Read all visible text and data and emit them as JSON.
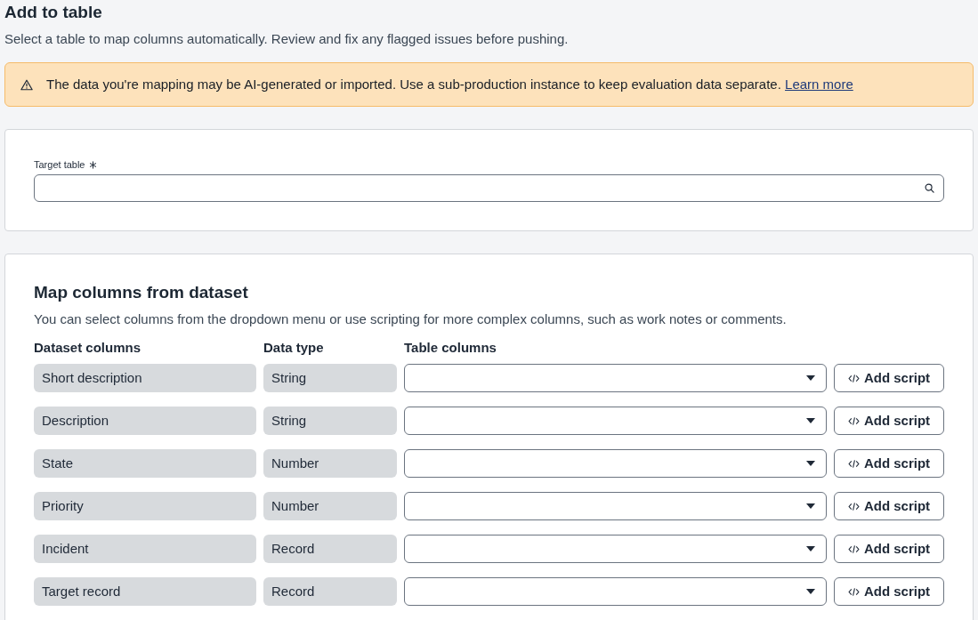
{
  "page": {
    "title": "Add to table",
    "subtitle": "Select a table to map columns automatically. Review and fix any flagged issues before pushing."
  },
  "warning": {
    "text": "The data you're mapping may be AI-generated or imported. Use a sub-production instance to keep evaluation data separate.",
    "link": "Learn more"
  },
  "target_table": {
    "label": "Target table",
    "required": true
  },
  "mapping": {
    "title": "Map columns from dataset",
    "description": "You can select columns from the dropdown menu or use scripting for more complex columns, such as work notes or comments.",
    "columns": [
      "Dataset columns",
      "Data type",
      "Table columns"
    ],
    "rows": [
      {
        "dataset_column": "Short description",
        "data_type": "String",
        "button": "Add script"
      },
      {
        "dataset_column": "Description",
        "data_type": "String",
        "button": "Add script"
      },
      {
        "dataset_column": "State",
        "data_type": "Number",
        "button": "Add script"
      },
      {
        "dataset_column": "Priority",
        "data_type": "Number",
        "button": "Add script"
      },
      {
        "dataset_column": "Incident",
        "data_type": "Record",
        "button": "Add script"
      },
      {
        "dataset_column": "Target record",
        "data_type": "Record",
        "button": "Add script"
      }
    ]
  }
}
